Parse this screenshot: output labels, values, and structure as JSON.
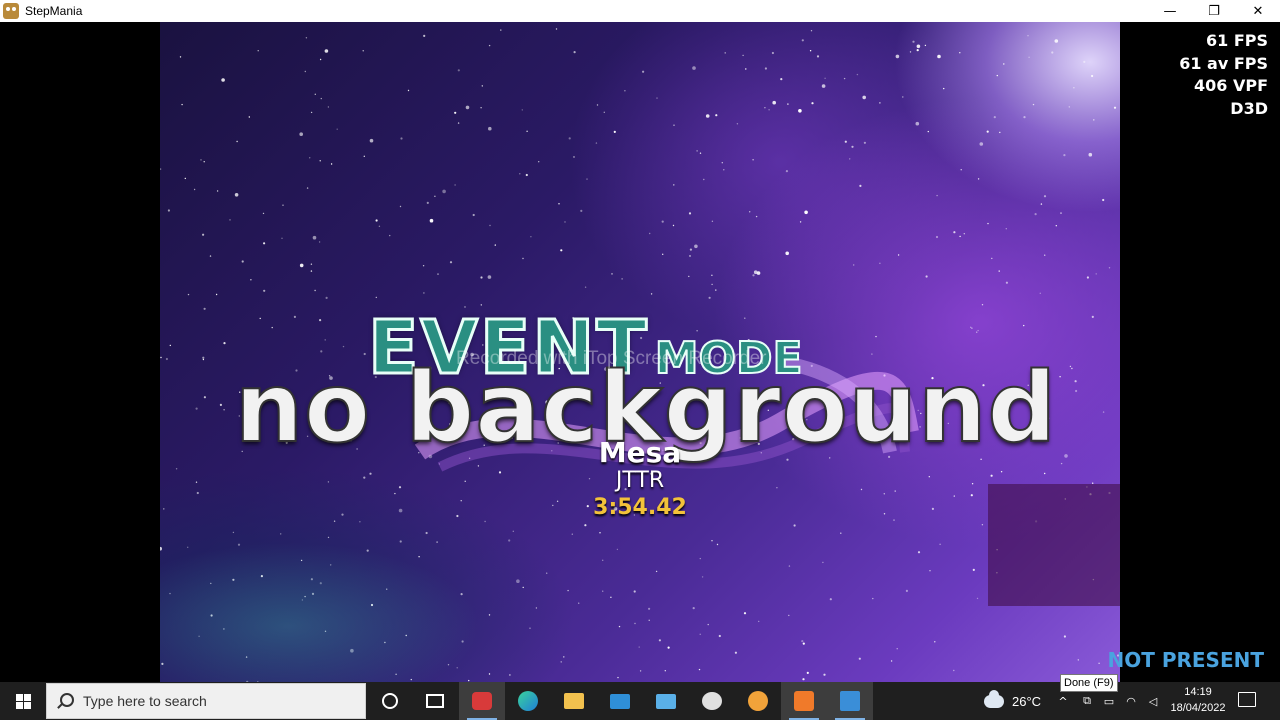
{
  "window": {
    "title": "StepMania",
    "minimize_glyph": "—",
    "restore_glyph": "❐",
    "close_glyph": "✕"
  },
  "game": {
    "banner": {
      "event_word": "EVENT",
      "mode_word": "MODE",
      "background_text": "no background"
    },
    "song": {
      "title": "Mesa",
      "artist": "JTTR",
      "length": "3:54.42"
    },
    "watermark": "Recorded with iTop Screen Recorder",
    "stats": {
      "fps": "61 FPS",
      "avg_fps": "61 av FPS",
      "vpf": "406 VPF",
      "renderer": "D3D"
    },
    "player_status": "NOT PRESENT"
  },
  "tooltip": "Done (F9)",
  "taskbar": {
    "search_placeholder": "Type here to search",
    "apps": [
      "cortana-icon",
      "task-view-icon",
      "screen-recorder-icon",
      "edge-icon",
      "file-explorer-icon",
      "mail-icon",
      "remote-desktop-icon",
      "app-icon",
      "browser-icon",
      "stepmania-icon",
      "photos-icon"
    ],
    "weather_temp": "26°C",
    "tray": {
      "chevron": "^",
      "time": "14:19",
      "date": "18/04/2022"
    }
  },
  "colors": {
    "accent_teal": "#2a8f82",
    "song_length": "#f3c23a",
    "not_present": "#4aa3df",
    "taskbar": "#1f1f1f"
  }
}
